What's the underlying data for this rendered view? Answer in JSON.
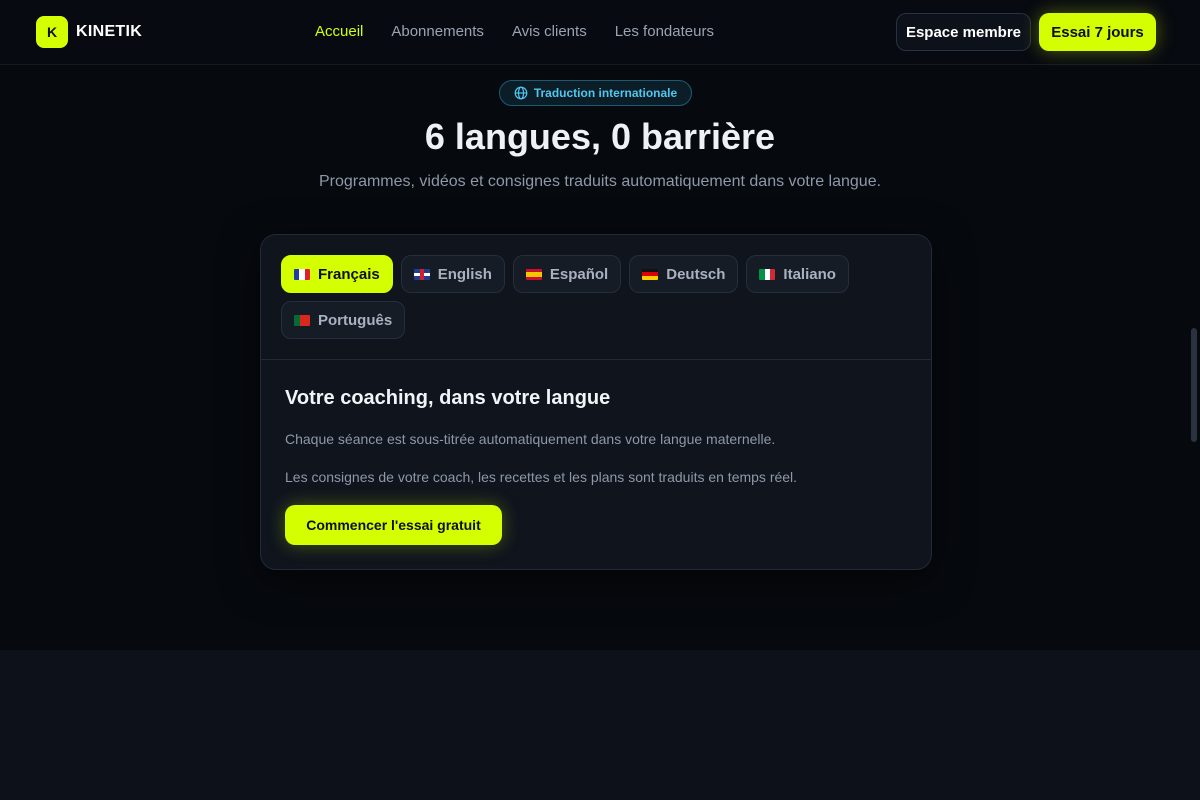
{
  "header": {
    "logo_letter": "K",
    "logo_text": "KINETIK",
    "nav": [
      "Accueil",
      "Abonnements",
      "Avis clients",
      "Les fondateurs"
    ],
    "active_nav": "Accueil",
    "member_button": "Espace membre",
    "trial_button": "Essai 7 jours"
  },
  "hero": {
    "badge": "Traduction internationale",
    "title": "6 langues, 0 barrière",
    "subtitle": "Programmes, vidéos et consignes traduits automatiquement dans votre langue."
  },
  "card": {
    "languages": [
      "Français",
      "English",
      "Español",
      "Deutsch",
      "Italiano",
      "Português"
    ],
    "selected_language": "Français",
    "title": "Votre coaching, dans votre langue",
    "paragraph_1": "Chaque séance est sous-titrée automatiquement dans votre langue maternelle.",
    "paragraph_2": "Les consignes de votre coach, les recettes et les plans sont traduits en temps réel.",
    "cta": "Commencer l'essai gratuit"
  },
  "colors": {
    "accent": "#d4ff00",
    "badge_text": "#4fc6ee",
    "background": "#06090e"
  },
  "icons": {
    "badge_icon": "globe-icon"
  }
}
